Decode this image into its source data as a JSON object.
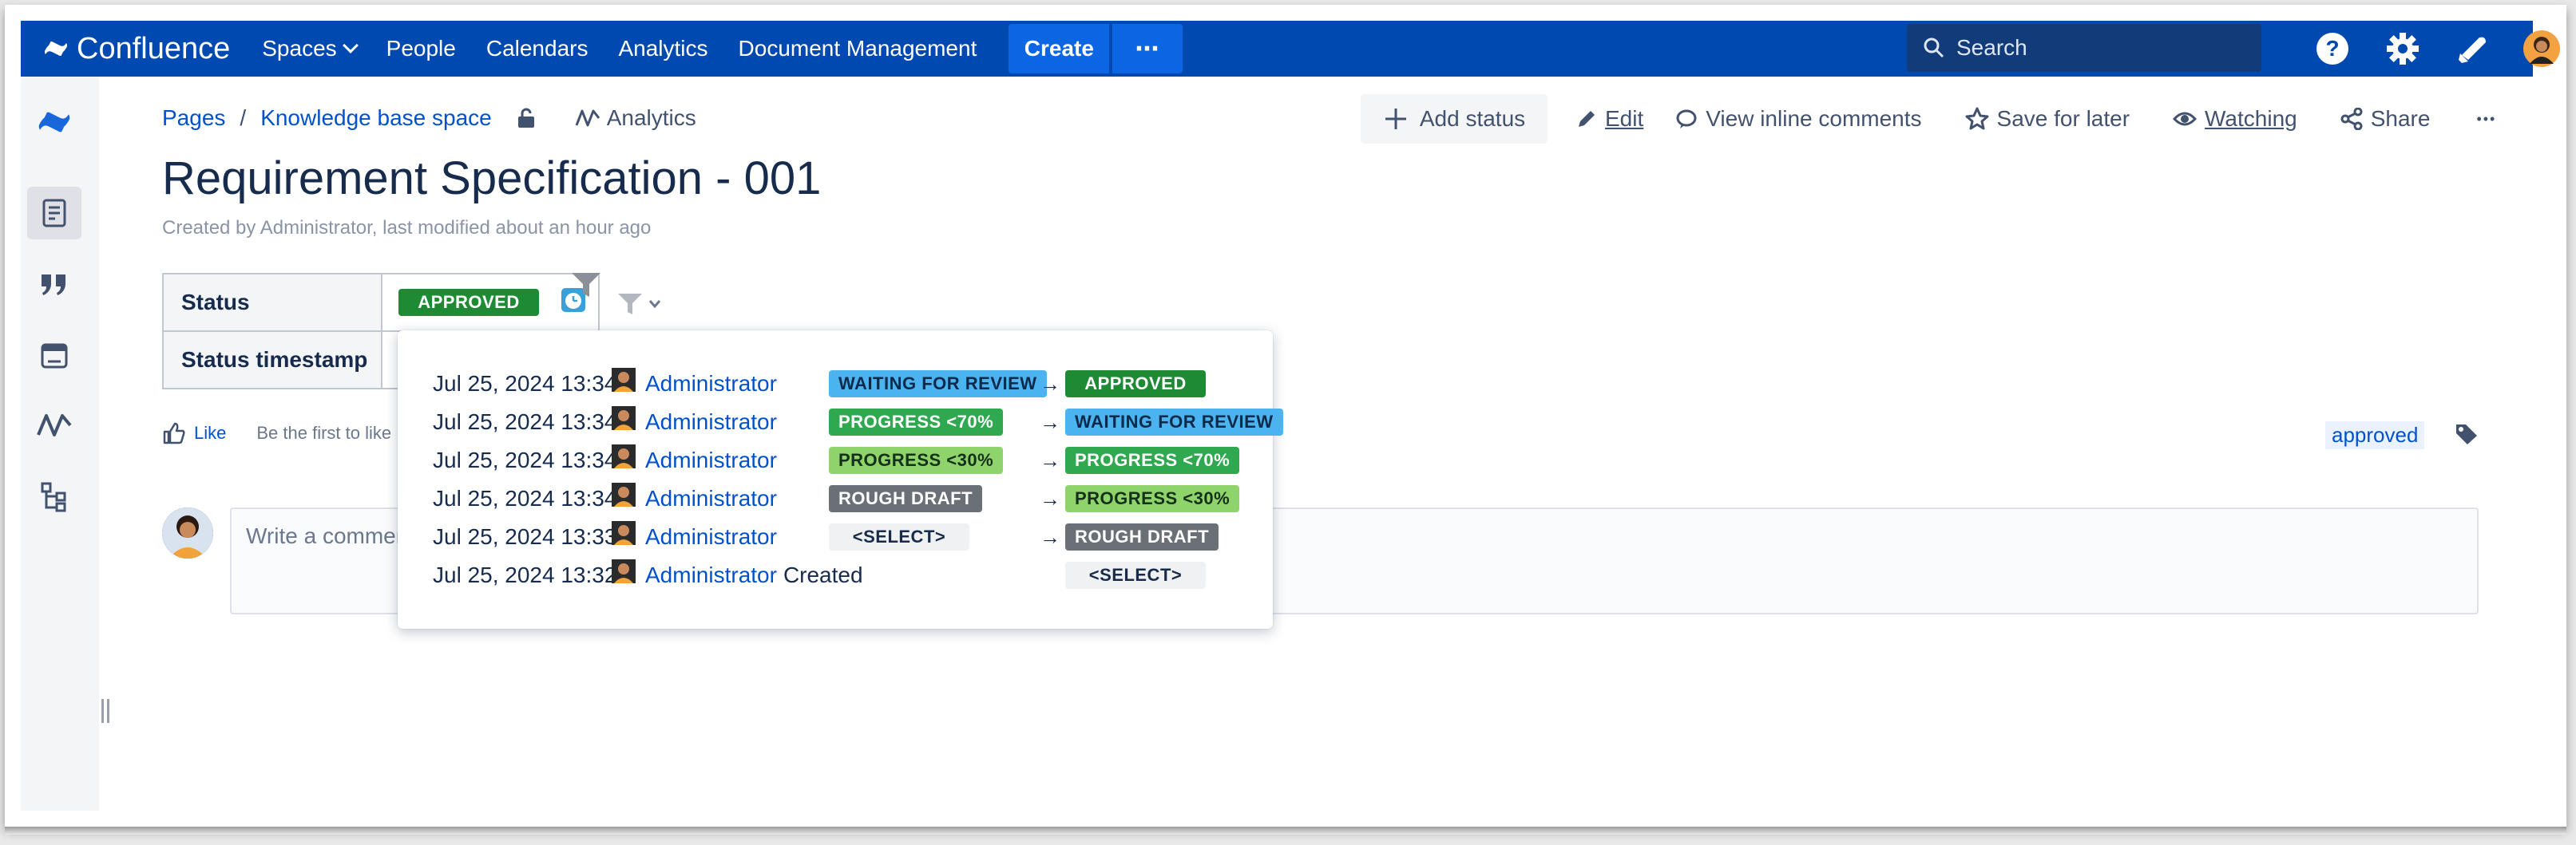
{
  "topnav": {
    "logo_text": "Confluence",
    "items": [
      "Spaces",
      "People",
      "Calendars",
      "Analytics",
      "Document Management"
    ],
    "create_label": "Create",
    "more_label": "⋯",
    "search_placeholder": "Search"
  },
  "breadcrumbs": {
    "pages": "Pages",
    "separator": "/",
    "space": "Knowledge base space",
    "analytics": "Analytics"
  },
  "actions": {
    "add_status": "Add status",
    "edit": "Edit",
    "view_inline_comments": "View inline comments",
    "save_for_later": "Save for later",
    "watching": "Watching",
    "share": "Share",
    "more": "•••"
  },
  "page": {
    "title": "Requirement Specification - 001",
    "byline": "Created by Administrator, last modified about an hour ago"
  },
  "status_table": {
    "status_header": "Status",
    "status_value": "APPROVED",
    "timestamp_header": "Status timestamp"
  },
  "like_row": {
    "like": "Like",
    "first": "Be the first to like"
  },
  "labels": [
    "approved"
  ],
  "comment": {
    "placeholder": "Write a comment"
  },
  "history": [
    {
      "time": "Jul 25, 2024 13:34",
      "user": "Administrator",
      "from": "WAITING FOR REVIEW",
      "arrow": "→",
      "to": "APPROVED"
    },
    {
      "time": "Jul 25, 2024 13:34",
      "user": "Administrator",
      "from": "PROGRESS <70%",
      "arrow": "→",
      "to": "WAITING FOR REVIEW"
    },
    {
      "time": "Jul 25, 2024 13:34",
      "user": "Administrator",
      "from": "PROGRESS <30%",
      "arrow": "→",
      "to": "PROGRESS <70%"
    },
    {
      "time": "Jul 25, 2024 13:34",
      "user": "Administrator",
      "from": "ROUGH DRAFT",
      "arrow": "→",
      "to": "PROGRESS <30%"
    },
    {
      "time": "Jul 25, 2024 13:33",
      "user": "Administrator",
      "from": "<SELECT>",
      "arrow": "→",
      "to": "ROUGH DRAFT"
    },
    {
      "time": "Jul 25, 2024 13:32",
      "user": "Administrator",
      "created": "Created",
      "to": "<SELECT>"
    }
  ],
  "colors": {
    "nav_bg": "#0049b0",
    "create_bg": "#0c66e4",
    "approved": "#1f8a34",
    "waiting": "#4bb3f0",
    "progress70": "#2fa84f",
    "progress30": "#8fd36b",
    "rough": "#6b6f76"
  },
  "icons": [
    "confluence-logo-icon",
    "chevron-down-icon",
    "search-icon",
    "help-icon",
    "gear-icon",
    "notification-icon",
    "avatar",
    "pages-icon",
    "quote-icon",
    "calendar-icon",
    "analytics-icon",
    "tree-icon",
    "lock-icon",
    "plus-icon",
    "pencil-icon",
    "comment-icon",
    "star-icon",
    "eye-icon",
    "share-icon",
    "clock-icon",
    "filter-icon",
    "thumbs-up-icon",
    "tag-icon"
  ]
}
